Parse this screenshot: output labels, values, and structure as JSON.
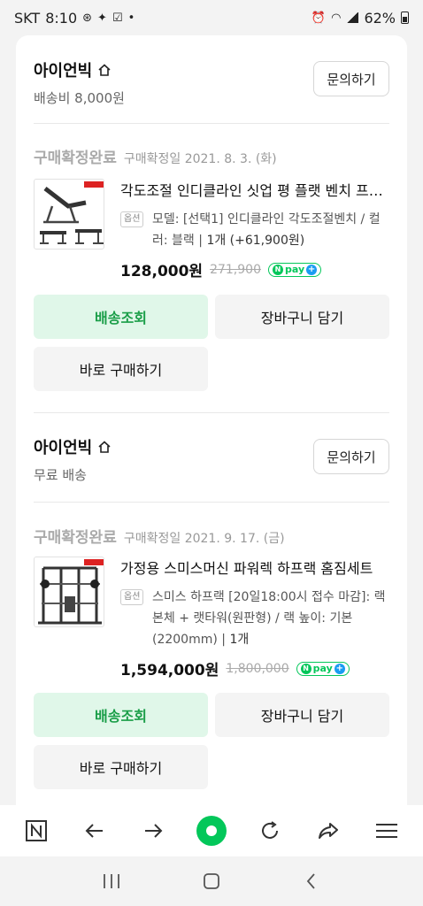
{
  "status_bar": {
    "carrier": "SKT",
    "time": "8:10",
    "battery": "62%"
  },
  "orders": [
    {
      "seller": "아이언빅",
      "shipping": "배송비 8,000원",
      "inquiry_label": "문의하기",
      "status": "구매확정완료",
      "status_date": "구매확정일 2021. 8. 3. (화)",
      "product_title": "각도조절 인디클라인 싯업 평 플랫 벤치 프리웨이트",
      "option_badge": "옵션",
      "option_text": "모델: [선택1] 인디클라인 각도조절벤치 / 컬러: 블랙",
      "quantity": "1개 (+61,900원)",
      "price": "128,000원",
      "original_price": "271,900",
      "npay_label": "pay",
      "actions": {
        "track": "배송조회",
        "cart": "장바구니 담기",
        "buy": "바로 구매하기"
      }
    },
    {
      "seller": "아이언빅",
      "shipping": "무료 배송",
      "inquiry_label": "문의하기",
      "status": "구매확정완료",
      "status_date": "구매확정일 2021. 9. 17. (금)",
      "product_title": "가정용 스미스머신 파워렉 하프랙 홈짐세트",
      "option_badge": "옵션",
      "option_text": "스미스 하프랙 [20일18:00시 접수 마감]: 랙본체 + 랫타워(원판형) / 랙 높이: 기본(2200mm)",
      "quantity": "1개",
      "price": "1,594,000원",
      "original_price": "1,800,000",
      "npay_label": "pay",
      "actions": {
        "track": "배송조회",
        "cart": "장바구니 담기",
        "buy": "바로 구매하기"
      }
    }
  ],
  "colors": {
    "accent_green": "#1a9e48",
    "npay_green": "#03c75a",
    "track_bg": "#e0f7e9"
  },
  "browser_nav": [
    "naver-n-icon",
    "back-icon",
    "forward-icon",
    "home-dot-icon",
    "reload-icon",
    "share-icon",
    "menu-icon"
  ],
  "system_nav": [
    "recents-icon",
    "home-icon",
    "back-icon"
  ]
}
